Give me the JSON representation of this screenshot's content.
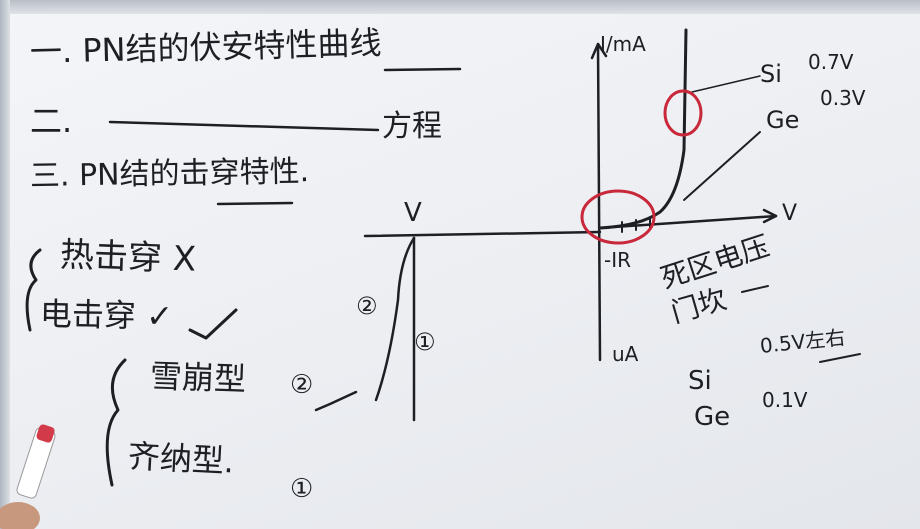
{
  "board": {
    "line1": "一. PN结的伏安特性曲线",
    "line2_prefix": "二.",
    "line2_suffix": "方程",
    "line3": "三. PN结的击穿特性.",
    "thermal": "热击穿 X",
    "electric": "电击穿 ✓",
    "avalanche": "雪崩型",
    "avalanche_mark": "②",
    "zener": "齐纳型.",
    "zener_mark": "①",
    "breakdown_v": "V",
    "circle_1": "①",
    "circle_2": "②",
    "axis_y": "I/mA",
    "axis_x": "V",
    "axis_neg": "uA",
    "reverse_current": "-IR",
    "si_label": "Si",
    "si_value": "0.7V",
    "ge_label": "Ge",
    "ge_value": "0.3V",
    "dead_zone": "死区电压",
    "threshold": "门坎",
    "si2_label": "Si",
    "si2_value": "0.5V左右",
    "ge2_label": "Ge",
    "ge2_value": "0.1V"
  },
  "colors": {
    "ink": "#1d1f24",
    "highlight": "#c8283a"
  },
  "icons": [
    "check-icon",
    "cross-icon",
    "marker-pen-icon"
  ]
}
